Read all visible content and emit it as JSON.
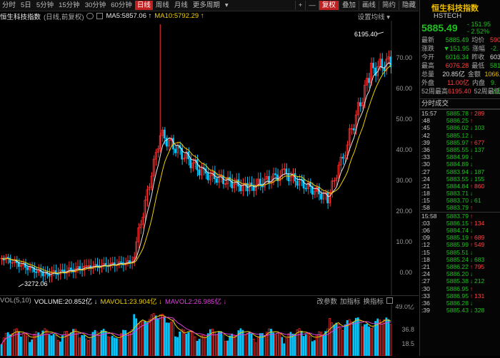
{
  "toolbar": {
    "periods": [
      {
        "label": "分时",
        "active": false
      },
      {
        "label": "5日",
        "active": false
      },
      {
        "label": "5分钟",
        "active": false
      },
      {
        "label": "15分钟",
        "active": false
      },
      {
        "label": "30分钟",
        "active": false
      },
      {
        "label": "60分钟",
        "active": false
      },
      {
        "label": "日线",
        "active": true
      },
      {
        "label": "周线",
        "active": false
      },
      {
        "label": "月线",
        "active": false
      },
      {
        "label": "更多周期",
        "active": false
      }
    ],
    "more_arrow": "▾",
    "right_buttons": [
      {
        "label": "+",
        "active": false
      },
      {
        "label": "—",
        "active": false
      },
      {
        "label": "复权",
        "active": true
      },
      {
        "label": "叠加",
        "active": false
      },
      {
        "label": "画线",
        "active": false
      },
      {
        "label": "简约",
        "active": false
      },
      {
        "label": "隐藏",
        "active": false
      }
    ]
  },
  "info": {
    "name": "恒生科技指数",
    "mode": "(日线,前复权)",
    "ma5": "MA5:5857.06 ↑",
    "ma10": "MA10:5792.29 ↑",
    "settings": "设置均线 ▾"
  },
  "chart": {
    "y_ticks": [
      "70.00",
      "60.00",
      "50.00",
      "40.00",
      "30.00",
      "20.00",
      "10.00",
      "0.00"
    ],
    "high_label": "6195.40",
    "low_label": "3272.06",
    "colors": {
      "up": "#ff3030",
      "down": "#00c8ff",
      "ma5": "#e6e6e6",
      "ma10": "#f0d000"
    }
  },
  "volume": {
    "label": "VOL(5,10)",
    "volume": "VOLUME:20.852亿 ↓",
    "mavol1": "MAVOL1:23.904亿 ↓",
    "mavol2": "MAVOL2:26.985亿 ↓",
    "tools": [
      "改参数",
      "加指标",
      "换指标"
    ],
    "y_ticks": [
      "49.0亿",
      "36.8",
      "18.5"
    ]
  },
  "right": {
    "title": "恒生科技指数",
    "code": "HSTECH",
    "price": "5885.49",
    "change": "- 151.95",
    "change_pct": "- 2.52%",
    "stats": [
      {
        "l": "最新",
        "v": "5885.49",
        "vc": "green",
        "l2": "均价",
        "v2": "590",
        "v2c": "red"
      },
      {
        "l": "涨跌",
        "v": "▼151.95",
        "vc": "green",
        "l2": "涨幅",
        "v2": "-2.",
        "v2c": "green"
      },
      {
        "l": "今开",
        "v": "6016.34",
        "vc": "green",
        "l2": "昨收",
        "v2": "603",
        "v2c": "white"
      },
      {
        "l": "最高",
        "v": "6076.28",
        "vc": "red",
        "l2": "最低",
        "v2": "581",
        "v2c": "green"
      },
      {
        "l": "总量",
        "v": "20.85亿",
        "vc": "white",
        "l2": "金额",
        "v2": "1066.",
        "v2c": "yellow"
      },
      {
        "l": "外盘",
        "v": "11.00亿",
        "vc": "red",
        "l2": "内盘",
        "v2": "9.",
        "v2c": "green"
      },
      {
        "l": "52周最高",
        "v": "6195.40",
        "vc": "red",
        "l2": "52周最低",
        "v2": "323",
        "v2c": "green"
      }
    ],
    "ticks_title": "分时成交",
    "ticks": [
      {
        "t": "15:57",
        "p": "5885.78",
        "a": "↑",
        "ac": "red",
        "q": "289",
        "qc": "red",
        "hdr": true
      },
      {
        "t": ":48",
        "p": "5886.25",
        "a": "↑",
        "ac": "red",
        "q": "",
        "qc": "white",
        "hdr": false
      },
      {
        "t": ":45",
        "p": "5886.02",
        "a": "↓",
        "ac": "green",
        "q": "103",
        "qc": "green",
        "hdr": false
      },
      {
        "t": ":42",
        "p": "5885.12",
        "a": "↓",
        "ac": "green",
        "q": "",
        "qc": "white",
        "hdr": false
      },
      {
        "t": ":39",
        "p": "5885.97",
        "a": "↑",
        "ac": "red",
        "q": "677",
        "qc": "red",
        "hdr": false
      },
      {
        "t": ":36",
        "p": "5885.55",
        "a": "↓",
        "ac": "green",
        "q": "137",
        "qc": "green",
        "hdr": false
      },
      {
        "t": ":33",
        "p": "5884.99",
        "a": "↓",
        "ac": "green",
        "q": "",
        "qc": "white",
        "hdr": false
      },
      {
        "t": ":30",
        "p": "5884.89",
        "a": "↓",
        "ac": "green",
        "q": "",
        "qc": "white",
        "hdr": false
      },
      {
        "t": ":27",
        "p": "5883.94",
        "a": "↓",
        "ac": "green",
        "q": "187",
        "qc": "green",
        "hdr": false
      },
      {
        "t": ":24",
        "p": "5883.55",
        "a": "↓",
        "ac": "green",
        "q": "155",
        "qc": "green",
        "hdr": false
      },
      {
        "t": ":21",
        "p": "5884.84",
        "a": "↑",
        "ac": "red",
        "q": "860",
        "qc": "red",
        "hdr": false
      },
      {
        "t": ":18",
        "p": "5883.71",
        "a": "↓",
        "ac": "green",
        "q": "",
        "qc": "white",
        "hdr": false
      },
      {
        "t": ":15",
        "p": "5883.70",
        "a": "↓",
        "ac": "green",
        "q": "61",
        "qc": "green",
        "hdr": false
      },
      {
        "t": ":58",
        "p": "5883.79",
        "a": "↑",
        "ac": "red",
        "q": "",
        "qc": "white",
        "hdr": false
      },
      {
        "t": "15:58",
        "p": "5883.79",
        "a": "↑",
        "ac": "red",
        "q": "",
        "qc": "white",
        "hdr": true
      },
      {
        "t": ":03",
        "p": "5886.15",
        "a": "↑",
        "ac": "red",
        "q": "134",
        "qc": "red",
        "hdr": false
      },
      {
        "t": ":06",
        "p": "5884.74",
        "a": "↓",
        "ac": "green",
        "q": "",
        "qc": "white",
        "hdr": false
      },
      {
        "t": ":09",
        "p": "5885.19",
        "a": "↑",
        "ac": "red",
        "q": "689",
        "qc": "red",
        "hdr": false
      },
      {
        "t": ":12",
        "p": "5885.99",
        "a": "↑",
        "ac": "red",
        "q": "549",
        "qc": "red",
        "hdr": false
      },
      {
        "t": ":15",
        "p": "5885.51",
        "a": "↓",
        "ac": "green",
        "q": "",
        "qc": "white",
        "hdr": false
      },
      {
        "t": ":18",
        "p": "5885.24",
        "a": "↓",
        "ac": "green",
        "q": "683",
        "qc": "green",
        "hdr": false
      },
      {
        "t": ":21",
        "p": "5886.22",
        "a": "↑",
        "ac": "red",
        "q": "795",
        "qc": "red",
        "hdr": false
      },
      {
        "t": ":24",
        "p": "5886.20",
        "a": "↓",
        "ac": "green",
        "q": "",
        "qc": "white",
        "hdr": false
      },
      {
        "t": ":27",
        "p": "5885.38",
        "a": "↓",
        "ac": "green",
        "q": "212",
        "qc": "green",
        "hdr": false
      },
      {
        "t": ":30",
        "p": "5886.95",
        "a": "↑",
        "ac": "red",
        "q": "",
        "qc": "white",
        "hdr": false
      },
      {
        "t": ":33",
        "p": "5886.95",
        "a": "↑",
        "ac": "red",
        "q": "131",
        "qc": "red",
        "hdr": false
      },
      {
        "t": ":36",
        "p": "5886.28",
        "a": "↓",
        "ac": "green",
        "q": "",
        "qc": "white",
        "hdr": false
      },
      {
        "t": ":39",
        "p": "5885.43",
        "a": "↓",
        "ac": "green",
        "q": "328",
        "qc": "green",
        "hdr": false
      }
    ]
  }
}
